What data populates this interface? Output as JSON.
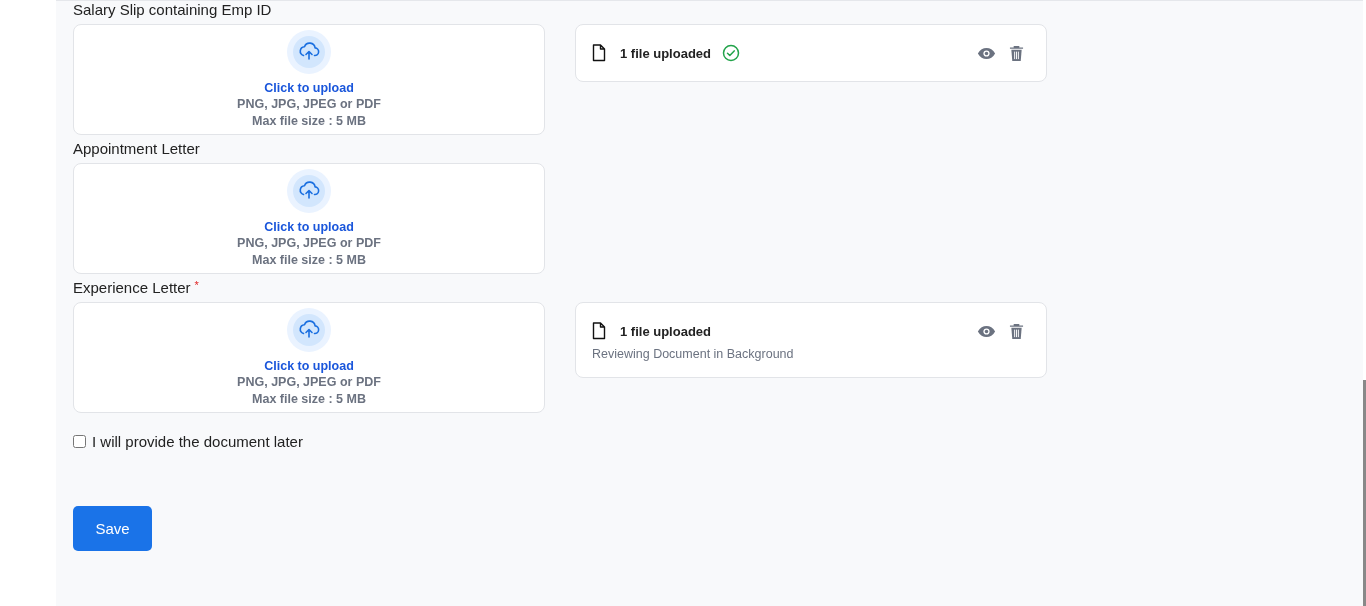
{
  "sections": [
    {
      "label": "Salary Slip containing Emp ID",
      "upload": {
        "action": "Click to upload",
        "formats": "PNG, JPG, JPEG or PDF",
        "max_size": "Max file size : 5 MB"
      },
      "file": {
        "status": "1 file uploaded",
        "verified": true
      }
    },
    {
      "label": "Appointment Letter",
      "upload": {
        "action": "Click to upload",
        "formats": "PNG, JPG, JPEG or PDF",
        "max_size": "Max file size : 5 MB"
      }
    },
    {
      "label": "Experience Letter",
      "required_mark": "*",
      "upload": {
        "action": "Click to upload",
        "formats": "PNG, JPG, JPEG or PDF",
        "max_size": "Max file size : 5 MB"
      },
      "file": {
        "status": "1 file uploaded",
        "verified": false,
        "note": "Reviewing Document in Background"
      }
    }
  ],
  "provide_later": {
    "label": "I will provide the document later",
    "checked": false
  },
  "save_button": "Save"
}
